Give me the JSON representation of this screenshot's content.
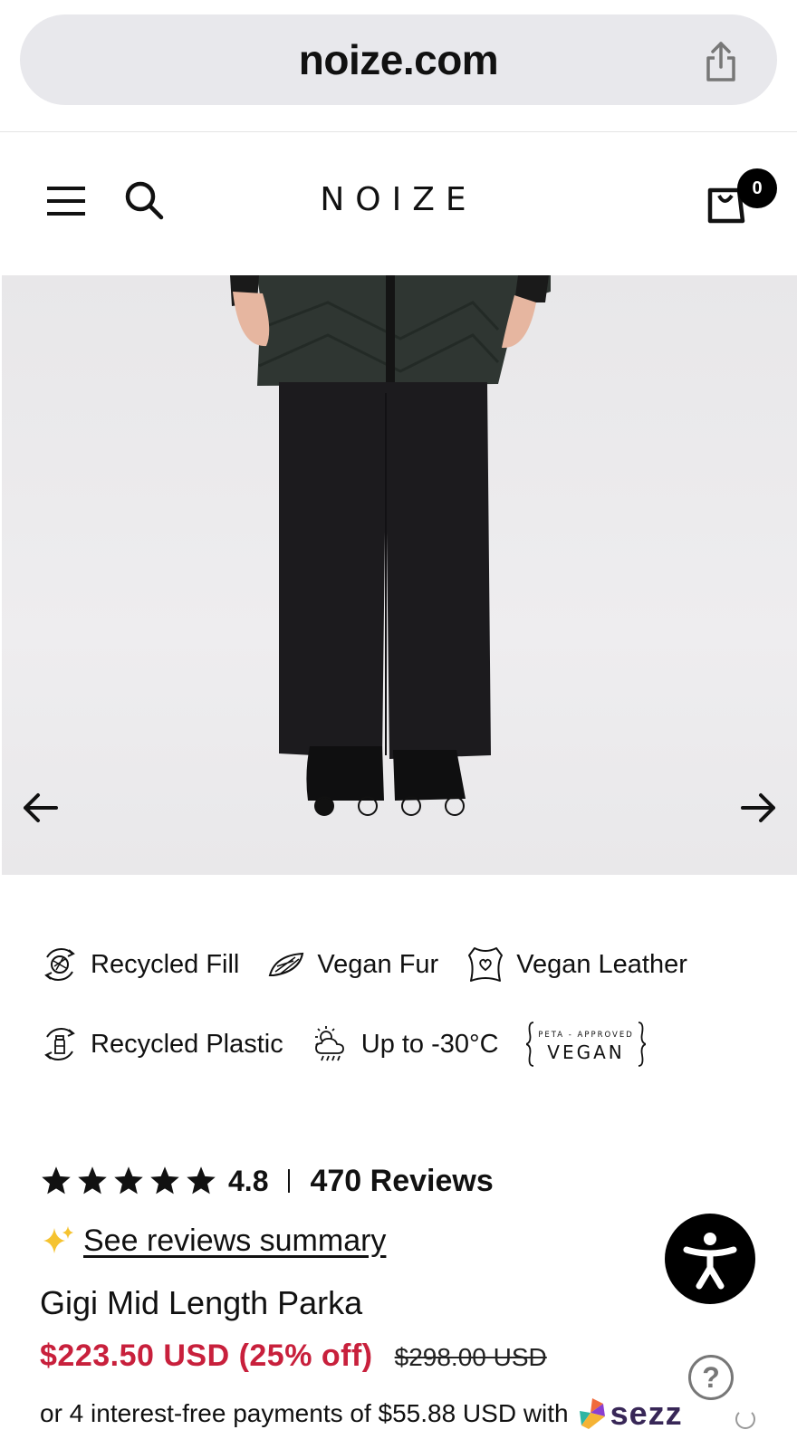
{
  "browser": {
    "url": "noize.com"
  },
  "header": {
    "logo_text": "NOIZE",
    "cart_count": "0"
  },
  "gallery": {
    "total_slides": 4,
    "active_slide": 1
  },
  "features": [
    {
      "label": "Recycled Fill",
      "icon": "recycled-fill-icon"
    },
    {
      "label": "Vegan Fur",
      "icon": "vegan-fur-icon"
    },
    {
      "label": "Vegan Leather",
      "icon": "vegan-leather-icon"
    },
    {
      "label": "Recycled Plastic",
      "icon": "recycled-plastic-icon"
    },
    {
      "label": "Up to -30°C",
      "icon": "weather-icon"
    }
  ],
  "peta_badge": {
    "top": "PETA - APPROVED",
    "main": "VEGAN"
  },
  "reviews": {
    "rating": "4.8",
    "stars": 5,
    "count_label": "470 Reviews",
    "summary_link": "See reviews summary"
  },
  "product": {
    "title": "Gigi Mid Length Parka",
    "sale_price": "$223.50 USD (25% off)",
    "original_price": "$298.00 USD",
    "installments": "or 4 interest-free payments of $55.88 USD with",
    "sezzle_word": "sezz"
  },
  "colors": {
    "sale_red": "#c8203c",
    "sezzle_purple": "#382757"
  }
}
